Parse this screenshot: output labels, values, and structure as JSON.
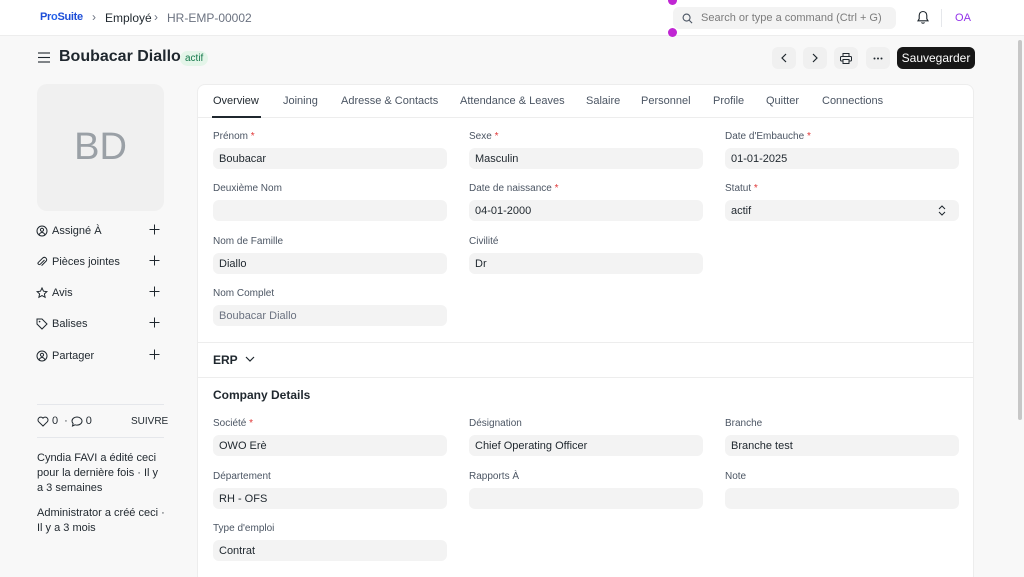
{
  "navbar": {
    "logo": {
      "p": "Pr",
      "o": "o",
      "rest": "Suite"
    },
    "breadcrumbs": [
      "Employé",
      "HR-EMP-00002"
    ],
    "search_placeholder": "Search or type a command (Ctrl + G)",
    "avatar_initials": "OA"
  },
  "header": {
    "title": "Boubacar Diallo",
    "status_badge": "actif",
    "save_label": "Sauvegarder"
  },
  "sidebar": {
    "avatar_initials": "BD",
    "items": [
      {
        "label": "Assigné À",
        "icon": "user-plus-icon"
      },
      {
        "label": "Pièces jointes",
        "icon": "paperclip-icon"
      },
      {
        "label": "Avis",
        "icon": "star-icon"
      },
      {
        "label": "Balises",
        "icon": "tag-icon"
      },
      {
        "label": "Partager",
        "icon": "share-user-icon"
      }
    ],
    "likes": "0",
    "comments": "0",
    "follow_label": "SUIVRE",
    "activity": [
      "Cyndia FAVI a édité ceci pour la dernière fois · Il y a 3 semaines",
      "Administrator a créé ceci · Il y a 3 mois"
    ]
  },
  "tabs": [
    "Overview",
    "Joining",
    "Adresse & Contacts",
    "Attendance & Leaves",
    "Salaire",
    "Personnel",
    "Profile",
    "Quitter",
    "Connections"
  ],
  "overview": {
    "prenom": {
      "label": "Prénom",
      "value": "Boubacar"
    },
    "sexe": {
      "label": "Sexe",
      "value": "Masculin"
    },
    "date_embauche": {
      "label": "Date d'Embauche",
      "value": "01-01-2025"
    },
    "deuxieme_nom": {
      "label": "Deuxième Nom",
      "value": ""
    },
    "date_naissance": {
      "label": "Date de naissance",
      "value": "04-01-2000"
    },
    "statut": {
      "label": "Statut",
      "value": "actif"
    },
    "nom_famille": {
      "label": "Nom de Famille",
      "value": "Diallo"
    },
    "civilite": {
      "label": "Civilité",
      "value": "Dr"
    },
    "nom_complet": {
      "label": "Nom Complet",
      "value": "Boubacar Diallo"
    }
  },
  "erp_section": {
    "label": "ERP"
  },
  "company": {
    "title": "Company Details",
    "societe": {
      "label": "Société",
      "value": "OWO Erè"
    },
    "designation": {
      "label": "Désignation",
      "value": "Chief Operating Officer"
    },
    "branche": {
      "label": "Branche",
      "value": "Branche test"
    },
    "departement": {
      "label": "Département",
      "value": "RH - OFS"
    },
    "rapports": {
      "label": "Rapports À",
      "value": ""
    },
    "note": {
      "label": "Note",
      "value": ""
    },
    "type_emploi": {
      "label": "Type d'emploi",
      "value": "Contrat"
    }
  }
}
